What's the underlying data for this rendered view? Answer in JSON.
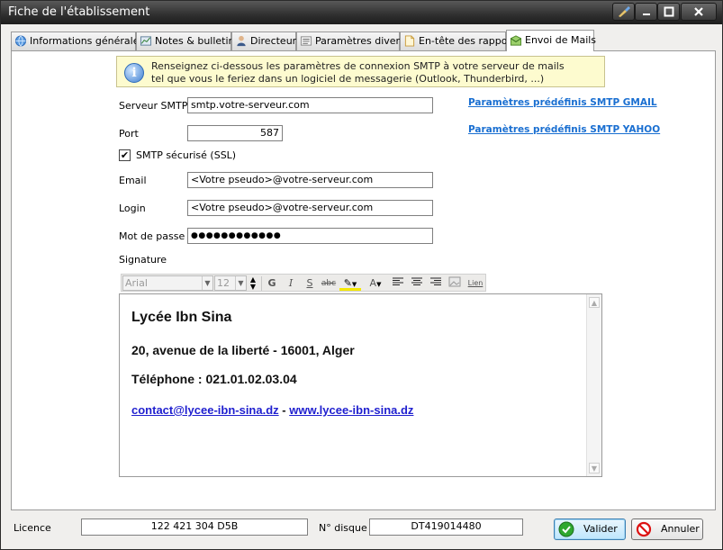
{
  "window": {
    "title": "Fiche de l'établissement"
  },
  "tabs": [
    {
      "label": "Informations générales",
      "icon": "globe-icon"
    },
    {
      "label": "Notes & bulletins",
      "icon": "chart-icon"
    },
    {
      "label": "Directeur",
      "icon": "person-icon"
    },
    {
      "label": "Paramètres divers",
      "icon": "list-icon"
    },
    {
      "label": "En-tête des rapports",
      "icon": "document-icon"
    },
    {
      "label": "Envoi de Mails",
      "icon": "mail-icon",
      "active": true
    }
  ],
  "info": {
    "line1": "Renseignez ci-dessous les paramètres de connexion SMTP à votre serveur de mails",
    "line2": "tel que vous le feriez dans un logiciel de messagerie (Outlook, Thunderbird, ...)"
  },
  "form": {
    "smtp_label": "Serveur SMTP",
    "smtp_value": "smtp.votre-serveur.com",
    "port_label": "Port",
    "port_value": "587",
    "ssl_label": "SMTP sécurisé (SSL)",
    "ssl_checked": "✔",
    "email_label": "Email",
    "email_value": "<Votre pseudo>@votre-serveur.com",
    "login_label": "Login",
    "login_value": "<Votre pseudo>@votre-serveur.com",
    "password_label": "Mot de passe",
    "password_value": "●●●●●●●●●●●●",
    "signature_label": "Signature"
  },
  "links": {
    "gmail": "Paramètres prédéfinis SMTP GMAIL",
    "yahoo": "Paramètres prédéfinis SMTP YAHOO"
  },
  "toolbar": {
    "font": "Arial",
    "size": "12",
    "bold": "G",
    "italic": "I",
    "strike": "S",
    "abc": "abc",
    "highlight": "✎",
    "fontcolor": "A",
    "link": "Lien"
  },
  "signature": {
    "name": "Lycée Ibn Sina",
    "address": "20, avenue de la liberté - 16001, Alger",
    "phone": "Téléphone : 021.01.02.03.04",
    "email": "contact@lycee-ibn-sina.dz",
    "separator": " - ",
    "website": "www.lycee-ibn-sina.dz"
  },
  "footer": {
    "licence_label": "Licence",
    "licence_value": "122 421 304 D5B",
    "disk_label": "N° disque",
    "disk_value": "DT419014480",
    "validate_label": "Valider",
    "cancel_label": "Annuler"
  },
  "colors": {
    "titlebar": "#2f2f2f",
    "link": "#1a6fd1",
    "info_bg": "#fdfbcf"
  }
}
